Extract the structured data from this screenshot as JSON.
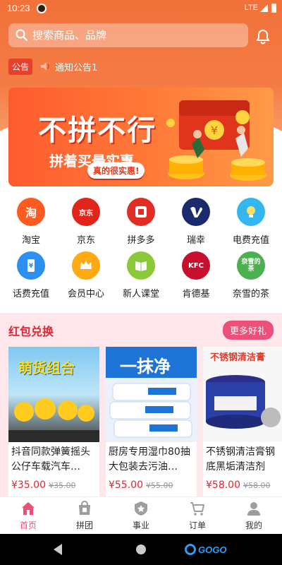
{
  "status_bar": {
    "time": "10:23",
    "network": "LTE"
  },
  "search": {
    "placeholder": "搜索商品、品牌"
  },
  "notice": {
    "badge": "公告",
    "text": "通知公告1"
  },
  "banner": {
    "title": "不拼不行",
    "subtitle": "拼着买最实惠",
    "pill": "真的很实惠!"
  },
  "grid": [
    {
      "label": "淘宝",
      "icon": "taobao-icon",
      "glyph": "淘",
      "color": "#ff5a1f"
    },
    {
      "label": "京东",
      "icon": "jd-icon",
      "glyph": "京东",
      "color": "#e1251b"
    },
    {
      "label": "拼多多",
      "icon": "pinduoduo-icon",
      "glyph": "",
      "color": "#e02e24"
    },
    {
      "label": "瑞幸",
      "icon": "luckin-icon",
      "glyph": "",
      "color": "#1a2a6c"
    },
    {
      "label": "电费充值",
      "icon": "lightbulb-icon",
      "glyph": "",
      "color": "#34b6ee"
    },
    {
      "label": "话费充值",
      "icon": "phone-recharge-icon",
      "glyph": "¥",
      "color": "#2d8ff0"
    },
    {
      "label": "会员中心",
      "icon": "crown-icon",
      "glyph": "",
      "color": "#ffaa12"
    },
    {
      "label": "新人课堂",
      "icon": "book-icon",
      "glyph": "",
      "color": "#8bc93b"
    },
    {
      "label": "肯德基",
      "icon": "kfc-icon",
      "glyph": "KFC",
      "color": "#c8102e"
    },
    {
      "label": "奈雪的茶",
      "icon": "nayuki-icon",
      "glyph": "奈雪的茶",
      "color": "#4caf50"
    }
  ],
  "section": {
    "title": "红包兑换",
    "more": "更多好礼",
    "products": [
      {
        "title": "抖音同款弹簧摇头公仔车载汽车…",
        "price": "¥35.00",
        "old_price": "¥35.00",
        "image_text": "萌货组合"
      },
      {
        "title": "厨房专用湿巾80抽大包装去污油…",
        "price": "¥55.00",
        "old_price": "¥55.00",
        "image_text": "一抹净"
      },
      {
        "title": "不锈钢清洁膏钢底黑垢清洁剂去…",
        "price": "¥58.00",
        "old_price": "¥58.00",
        "image_text": "不锈钢清洁膏"
      }
    ]
  },
  "tabbar": [
    {
      "label": "首页",
      "icon": "home-icon",
      "active": true
    },
    {
      "label": "拼团",
      "icon": "group-buy-icon",
      "active": false
    },
    {
      "label": "事业",
      "icon": "star-badge-icon",
      "active": false
    },
    {
      "label": "订单",
      "icon": "cart-icon",
      "active": false
    },
    {
      "label": "我的",
      "icon": "person-icon",
      "active": false
    }
  ],
  "watermark": "GOGO",
  "colors": {
    "accent": "#ec4f79",
    "header": "#f2703a",
    "price": "#e8232f"
  }
}
